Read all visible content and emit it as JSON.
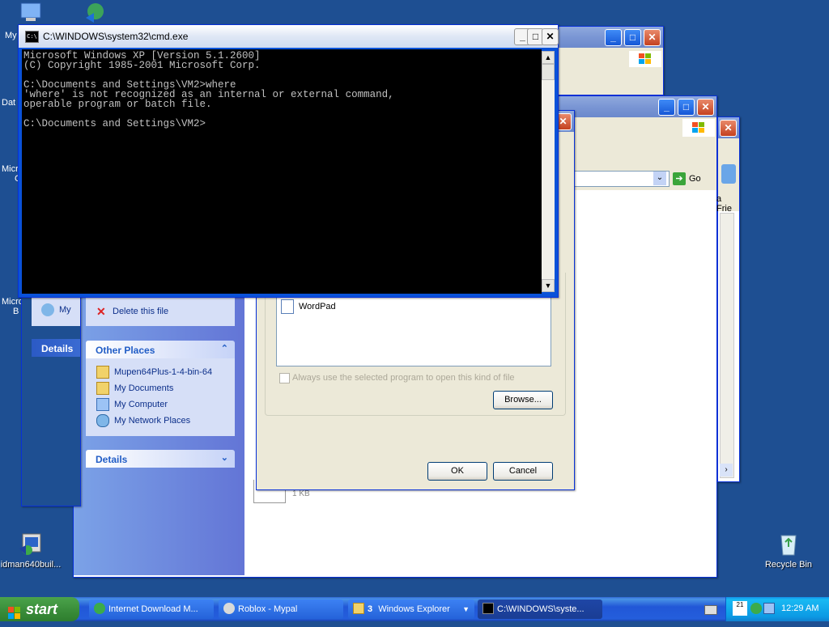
{
  "desktop": {
    "icons": [
      {
        "label": "idman640buil...",
        "icon": "installer-icon"
      },
      {
        "label": "Recycle Bin",
        "icon": "recycle-bin-icon"
      }
    ],
    "partial_labels": [
      "My",
      "Dat",
      "Micro",
      "C",
      "Micro",
      "B"
    ]
  },
  "explorer_back": {
    "panels": {
      "file_tasks_delete": "Delete this file",
      "details_left": "Details",
      "other_places": {
        "title": "Other Places",
        "items": [
          {
            "label": "Mupen64Plus-1-4-bin-64",
            "icon": "folder-icon"
          },
          {
            "label": "My Documents",
            "icon": "my-documents-icon"
          },
          {
            "label": "My Computer",
            "icon": "my-computer-icon"
          },
          {
            "label": "My Network Places",
            "icon": "network-places-icon"
          }
        ]
      },
      "details_title": "Details"
    },
    "file_size": "1 KB",
    "partial_my": "My"
  },
  "explorer_right": {
    "go_label": "Go",
    "partial_text": "a Frie"
  },
  "openwith": {
    "program": "WordPad",
    "always_use": "Always use the selected program to open this kind of file",
    "browse": "Browse...",
    "ok": "OK",
    "cancel": "Cancel"
  },
  "cmd": {
    "title": "C:\\WINDOWS\\system32\\cmd.exe",
    "lines": [
      "Microsoft Windows XP [Version 5.1.2600]",
      "(C) Copyright 1985-2001 Microsoft Corp.",
      "",
      "C:\\Documents and Settings\\VM2>where",
      "'where' is not recognized as an internal or external command,",
      "operable program or batch file.",
      "",
      "C:\\Documents and Settings\\VM2>"
    ],
    "colors": {
      "bg": "#000000",
      "fg": "#c0c0c0"
    }
  },
  "taskbar": {
    "start": "start",
    "buttons": [
      {
        "label": "Internet Download M...",
        "icon": "idm-icon"
      },
      {
        "label": "Roblox - Mypal",
        "icon": "mypal-icon"
      },
      {
        "label": "3",
        "label2": "Windows Explorer",
        "icon": "folder-icon"
      },
      {
        "label": "C:\\WINDOWS\\syste...",
        "icon": "cmd-icon"
      }
    ],
    "tray": {
      "ime": "21",
      "clock": "12:29 AM"
    }
  }
}
